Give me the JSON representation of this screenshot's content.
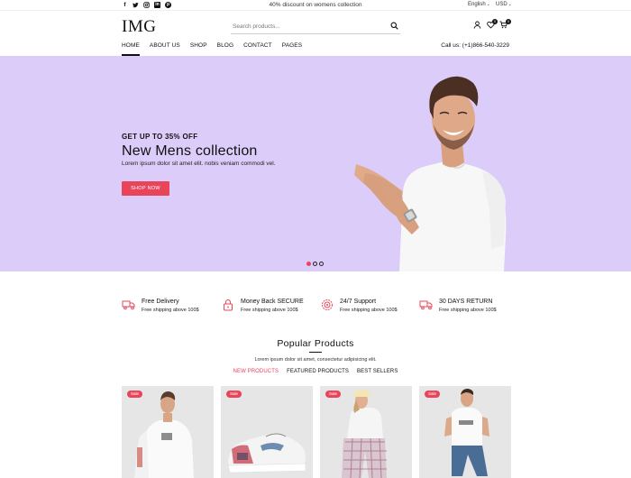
{
  "topbar": {
    "socials": [
      "f",
      "t",
      "ig",
      "in",
      "p"
    ],
    "promo": "40% discount on womens collection",
    "language": "English",
    "currency": "USD"
  },
  "header": {
    "logo": "IMG",
    "search_placeholder": "Search products...",
    "wishlist_count": "0",
    "cart_count": "0"
  },
  "nav": {
    "items": [
      "HOME",
      "ABOUT US",
      "SHOP",
      "BLOG",
      "CONTACT",
      "PAGES"
    ],
    "call_us": "Call us: (+1)866-540-3229"
  },
  "hero": {
    "subtitle": "GET UP TO 35% OFF",
    "title": "New Mens collection",
    "text": "Lorem ipsum dolor sit amet elit. nobis veniam commodi vel.",
    "button": "SHOP NOW",
    "background_color": "#dcccfa",
    "slides": 3,
    "active_slide": 1
  },
  "features": [
    {
      "icon": "truck-icon",
      "title": "Free Delivery",
      "subtitle": "Free shipping above 100$"
    },
    {
      "icon": "lock-icon",
      "title": "Money Back SECURE",
      "subtitle": "Free shipping above 100$"
    },
    {
      "icon": "support-icon",
      "title": "24/7 Support",
      "subtitle": "Free shipping above 100$"
    },
    {
      "icon": "truck-icon",
      "title": "30 DAYS RETURN",
      "subtitle": "Free shipping above 100$"
    }
  ],
  "popular": {
    "title": "Popular Products",
    "subtitle": "Lorem ipsum dolor sit amet, consectetur adipisicing elit.",
    "tabs": [
      "NEW PRODUCTS",
      "FEATURED PRODUCTS",
      "BEST SELLERS"
    ],
    "active_tab": 0
  },
  "products": [
    {
      "badge": "Sale"
    },
    {
      "badge": "Sale"
    },
    {
      "badge": "Sale"
    },
    {
      "badge": "Sale"
    }
  ],
  "colors": {
    "accent": "#e9455a",
    "hero_bg": "#dcccfa"
  }
}
